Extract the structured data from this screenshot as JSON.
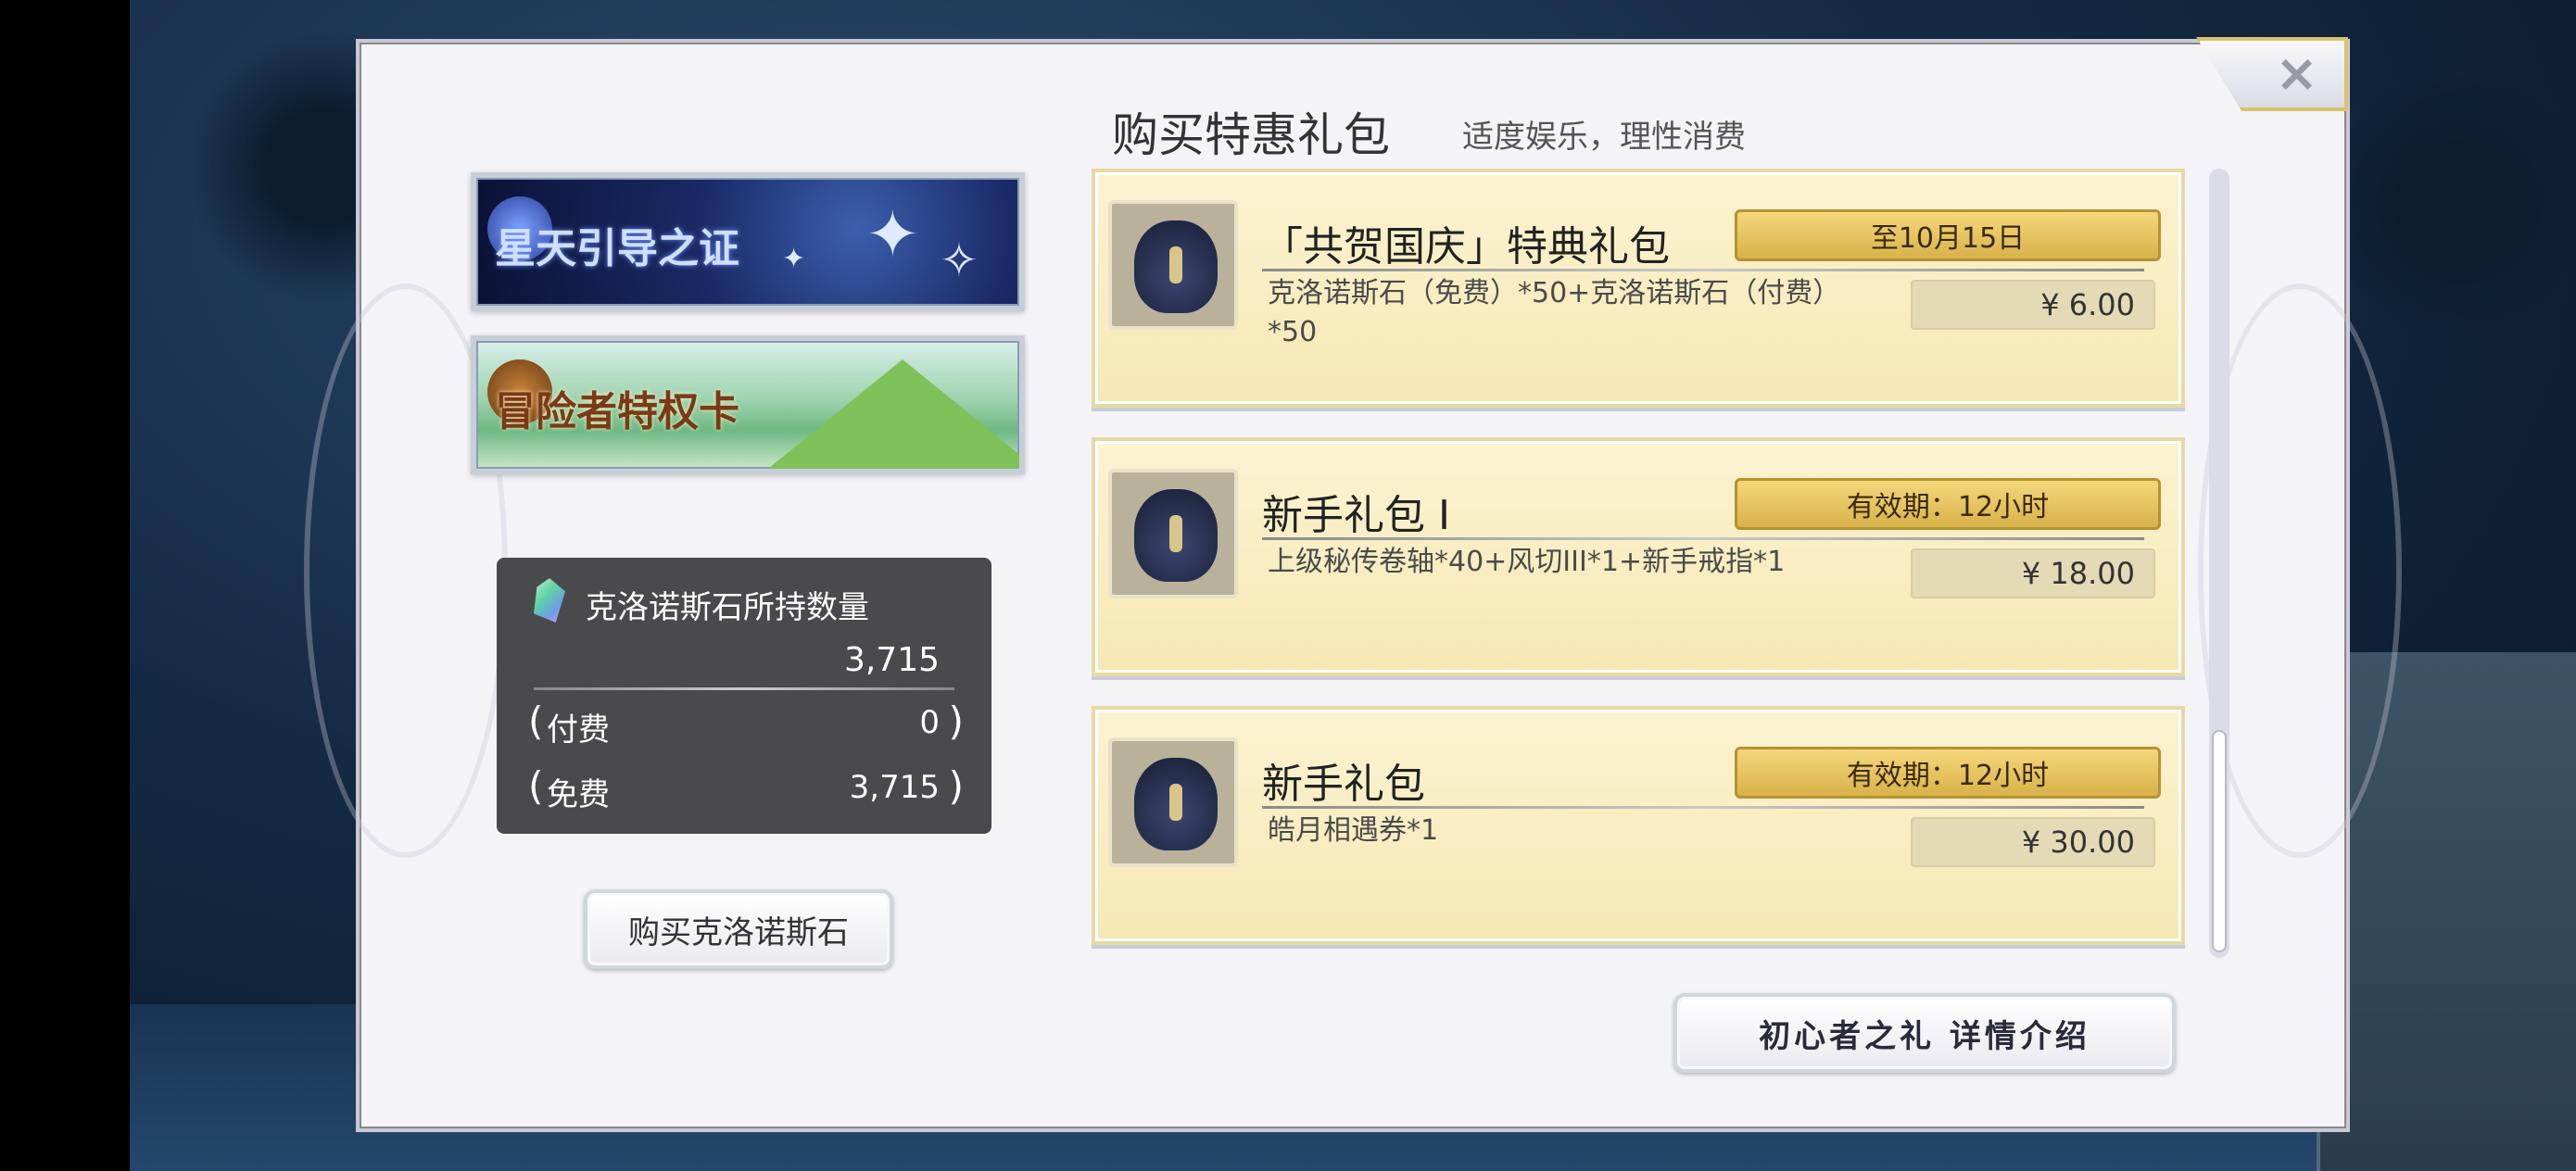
{
  "header": {
    "title": "购买特惠礼包",
    "subtitle": "适度娱乐，理性消费"
  },
  "banners": [
    {
      "label": "星天引导之证",
      "icon": "star-emblem-icon"
    },
    {
      "label": "冒险者特权卡",
      "icon": "adventurer-emblem-icon"
    }
  ],
  "stone_panel": {
    "label": "克洛诺斯石所持数量",
    "total": "3,715",
    "paid_label": "付费",
    "paid_value": "0",
    "free_label": "免费",
    "free_value": "3,715",
    "paren_open": "(",
    "paren_close": ")"
  },
  "buy_stone_button": "购买克洛诺斯石",
  "packs": [
    {
      "title": "「共贺国庆」特典礼包",
      "badge": "至10月15日",
      "description": "克洛诺斯石（免费）*50+克洛诺斯石（付费）*50",
      "price": "¥  6.00"
    },
    {
      "title": "新手礼包 I",
      "badge": "有效期：12小时",
      "description": "上级秘传卷轴*40+风切III*1+新手戒指*1",
      "price": "¥  18.00"
    },
    {
      "title": "新手礼包",
      "badge": "有效期：12小时",
      "description": "皓月相遇券*1",
      "price": "¥  30.00"
    }
  ],
  "intro_button": "初心者之礼 详情介绍",
  "close_icon": "×",
  "colors": {
    "dialog_bg": "#f4f3f8",
    "pack_bg": "#f6e8b4",
    "badge_gold": "#e0bd5a",
    "panel_dark": "#4a4a4c"
  }
}
